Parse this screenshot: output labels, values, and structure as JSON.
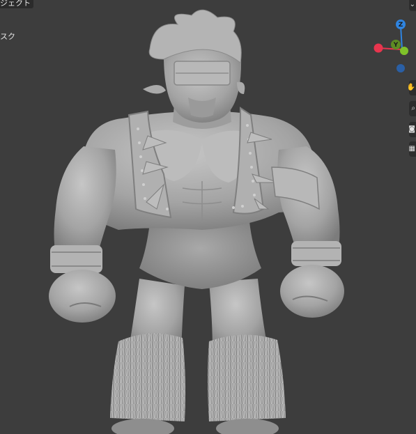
{
  "header": {
    "mode_label": "ジェクト"
  },
  "overlay": {
    "mask_label": "スク"
  },
  "gizmo": {
    "z_label": "Z",
    "y_label": "Y",
    "colors": {
      "x": "#e8354e",
      "y": "#7fc22a",
      "z": "#2f84e0",
      "z_neg": "#2a5fa5",
      "y_neg": "#5d8b23"
    }
  },
  "sidebar": {
    "icons": [
      "move-view-icon",
      "zoom-icon",
      "camera-icon",
      "grid-icon"
    ]
  },
  "viewport": {
    "background": "#3d3d3d",
    "model_color": "#a8a8a8"
  }
}
